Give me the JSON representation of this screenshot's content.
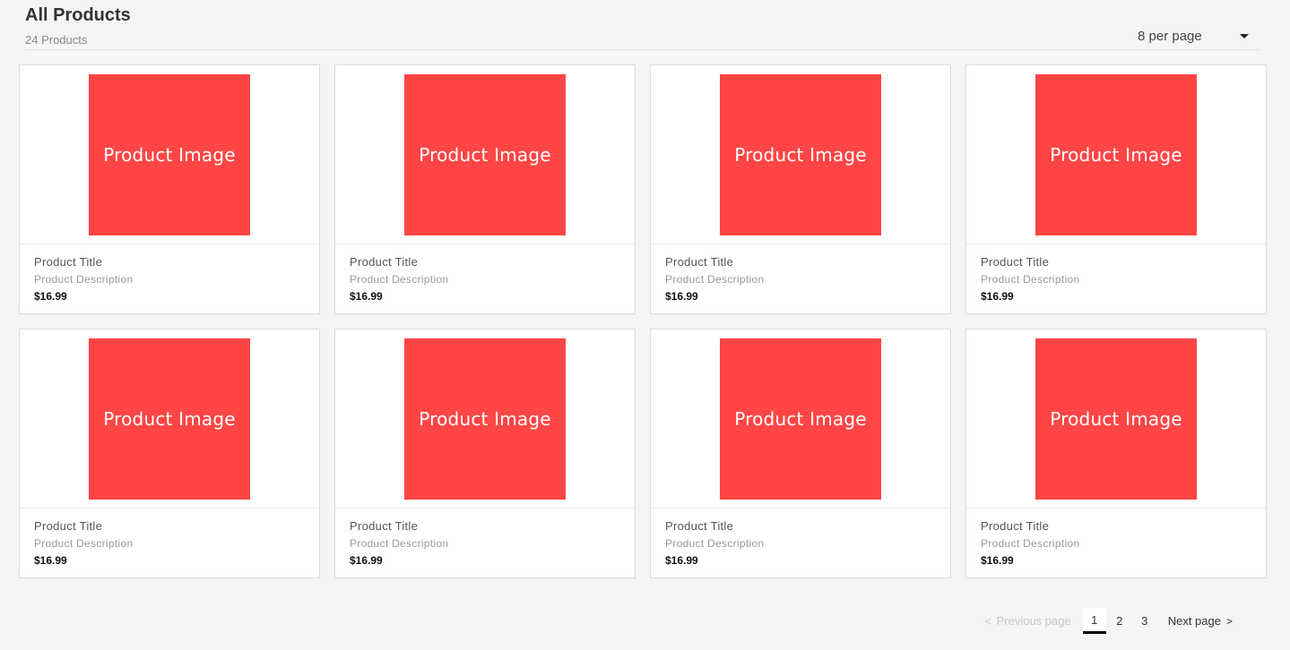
{
  "header": {
    "title": "All Products",
    "count": "24 Products",
    "per_page": "8 per page"
  },
  "colors": {
    "product_image_bg": "#ff4545"
  },
  "products": [
    {
      "image_text": "Product Image",
      "title": "Product Title",
      "description": "Product Description",
      "price": "$16.99"
    },
    {
      "image_text": "Product Image",
      "title": "Product Title",
      "description": "Product Description",
      "price": "$16.99"
    },
    {
      "image_text": "Product Image",
      "title": "Product Title",
      "description": "Product Description",
      "price": "$16.99"
    },
    {
      "image_text": "Product Image",
      "title": "Product Title",
      "description": "Product Description",
      "price": "$16.99"
    },
    {
      "image_text": "Product Image",
      "title": "Product Title",
      "description": "Product Description",
      "price": "$16.99"
    },
    {
      "image_text": "Product Image",
      "title": "Product Title",
      "description": "Product Description",
      "price": "$16.99"
    },
    {
      "image_text": "Product Image",
      "title": "Product Title",
      "description": "Product Description",
      "price": "$16.99"
    },
    {
      "image_text": "Product Image",
      "title": "Product Title",
      "description": "Product Description",
      "price": "$16.99"
    }
  ],
  "pagination": {
    "prev_icon": "<",
    "prev_label": "Previous page",
    "pages": [
      "1",
      "2",
      "3"
    ],
    "current": "1",
    "next_label": "Next page",
    "next_icon": ">"
  }
}
